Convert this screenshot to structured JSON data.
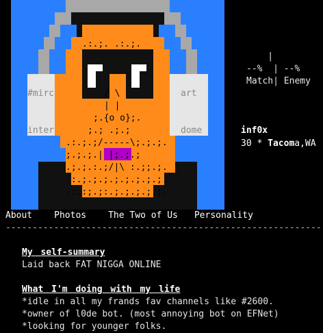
{
  "avatar": {
    "face_color": "#ff8c1a",
    "headphone_color": "#2a7fff",
    "art_lines": [
      "  .:.;.     .:.;.",
      "      / \\",
      "      |   |",
      "   ;.{o o};.",
      "  ;.;   .;.;",
      ".:.;.;/-----\\;.;.;.",
      ";.;.;.|       |;.;.;",
      ".;.;.:.;/|\\ :.;;.;.",
      ".:.;.;.;.;.;.;.;.;.",
      ".:.:;.;:.;.;.;.;.;."
    ],
    "left_labels": [
      "#mirc",
      "inter"
    ],
    "right_labels": [
      "art",
      "dome"
    ]
  },
  "match": {
    "divider_line": "    |",
    "percent_line": "--%  | --%",
    "labels_line": "Match| Enemy"
  },
  "user": {
    "username": "inf0x",
    "age": "30",
    "separator": "*",
    "city_bold": "Tacom",
    "city_rest": "a,WA"
  },
  "nav": {
    "tabs": [
      "About",
      "Photos",
      "The Two of Us",
      "Personality"
    ]
  },
  "divider": "----------------------------------------------------------------------",
  "summary": {
    "heading": "My self-summary",
    "text": "Laid back FAT NIGGA ONLINE"
  },
  "life": {
    "heading": "What I'm doing with my life",
    "lines": [
      "*idle in all my frands fav channels like #2600.",
      "*owner of l0de bot. (most annoying bot on EFNet)",
      "*looking for younger folks."
    ]
  }
}
